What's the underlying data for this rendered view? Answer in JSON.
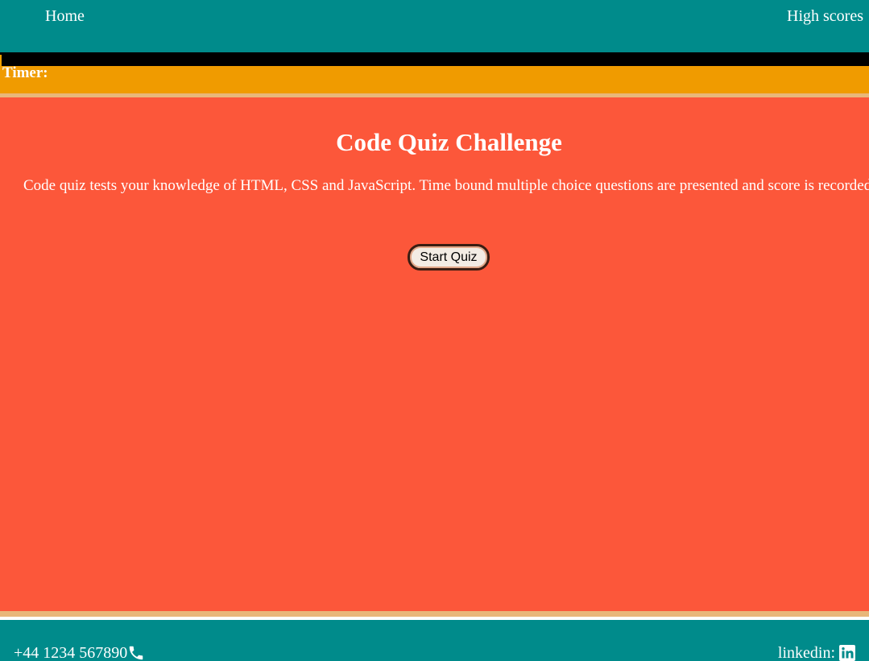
{
  "nav": {
    "home_label": "Home",
    "high_scores_label": "High scores"
  },
  "timer": {
    "label": "Timer:"
  },
  "main": {
    "title": "Code Quiz Challenge",
    "description": "Code quiz tests your knowledge of HTML, CSS and JavaScript. Time bound multiple choice questions are presented and score is recorded.",
    "start_button_label": "Start Quiz"
  },
  "footer": {
    "phone": "+44 1234 567890",
    "phone_icon": "phone-icon",
    "linkedin_label": "linkedin:",
    "linkedin_icon": "linkedin-icon"
  },
  "colors": {
    "header_footer": "#008b8b",
    "timer_bar": "#f09b00",
    "main_background": "#fc573a",
    "accent_line": "#e8b77a"
  }
}
